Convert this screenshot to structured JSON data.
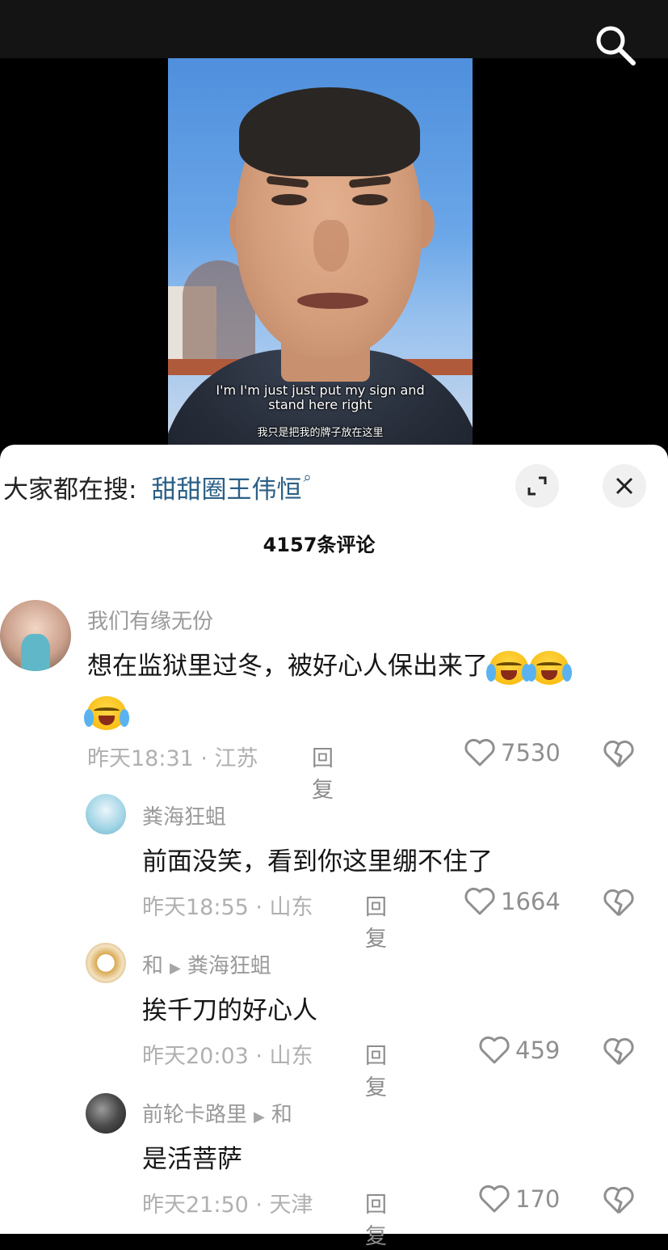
{
  "video": {
    "subtitle_en_line1": "I'm I'm just just put my sign and",
    "subtitle_en_line2": "stand here right",
    "subtitle_zh": "我只是把我的牌子放在这里"
  },
  "search_suggest": {
    "label": "大家都在搜:",
    "keyword": "甜甜圈王伟恒"
  },
  "comments_header": {
    "count_label": "4157条评论"
  },
  "comments": [
    {
      "author": "我们有缘无份",
      "text": "想在监狱里过冬，被好心人保出来了",
      "time": "昨天18:31 · 江苏",
      "reply_label": "回复",
      "likes": "7530"
    },
    {
      "author": "粪海狂蛆",
      "text": "前面没笑，看到你这里绷不住了",
      "time": "昨天18:55 · 山东",
      "reply_label": "回复",
      "likes": "1664"
    },
    {
      "author": "和",
      "reply_to": "粪海狂蛆",
      "text": "挨千刀的好心人",
      "time": "昨天20:03 · 山东",
      "reply_label": "回复",
      "likes": "459"
    },
    {
      "author": "前轮卡路里",
      "reply_to": "和",
      "text": "是活菩萨",
      "time": "昨天21:50 · 天津",
      "reply_label": "回复",
      "likes": "170"
    }
  ],
  "icons": {
    "search": "search-icon",
    "expand": "expand-icon",
    "close": "close-icon",
    "like": "heart-icon",
    "dislike": "broken-heart-icon",
    "emoji": "laughing-crying-emoji"
  },
  "colors": {
    "keyword": "#2b5f86",
    "meta": "#b0b0b0",
    "author": "#9a9a9a"
  }
}
